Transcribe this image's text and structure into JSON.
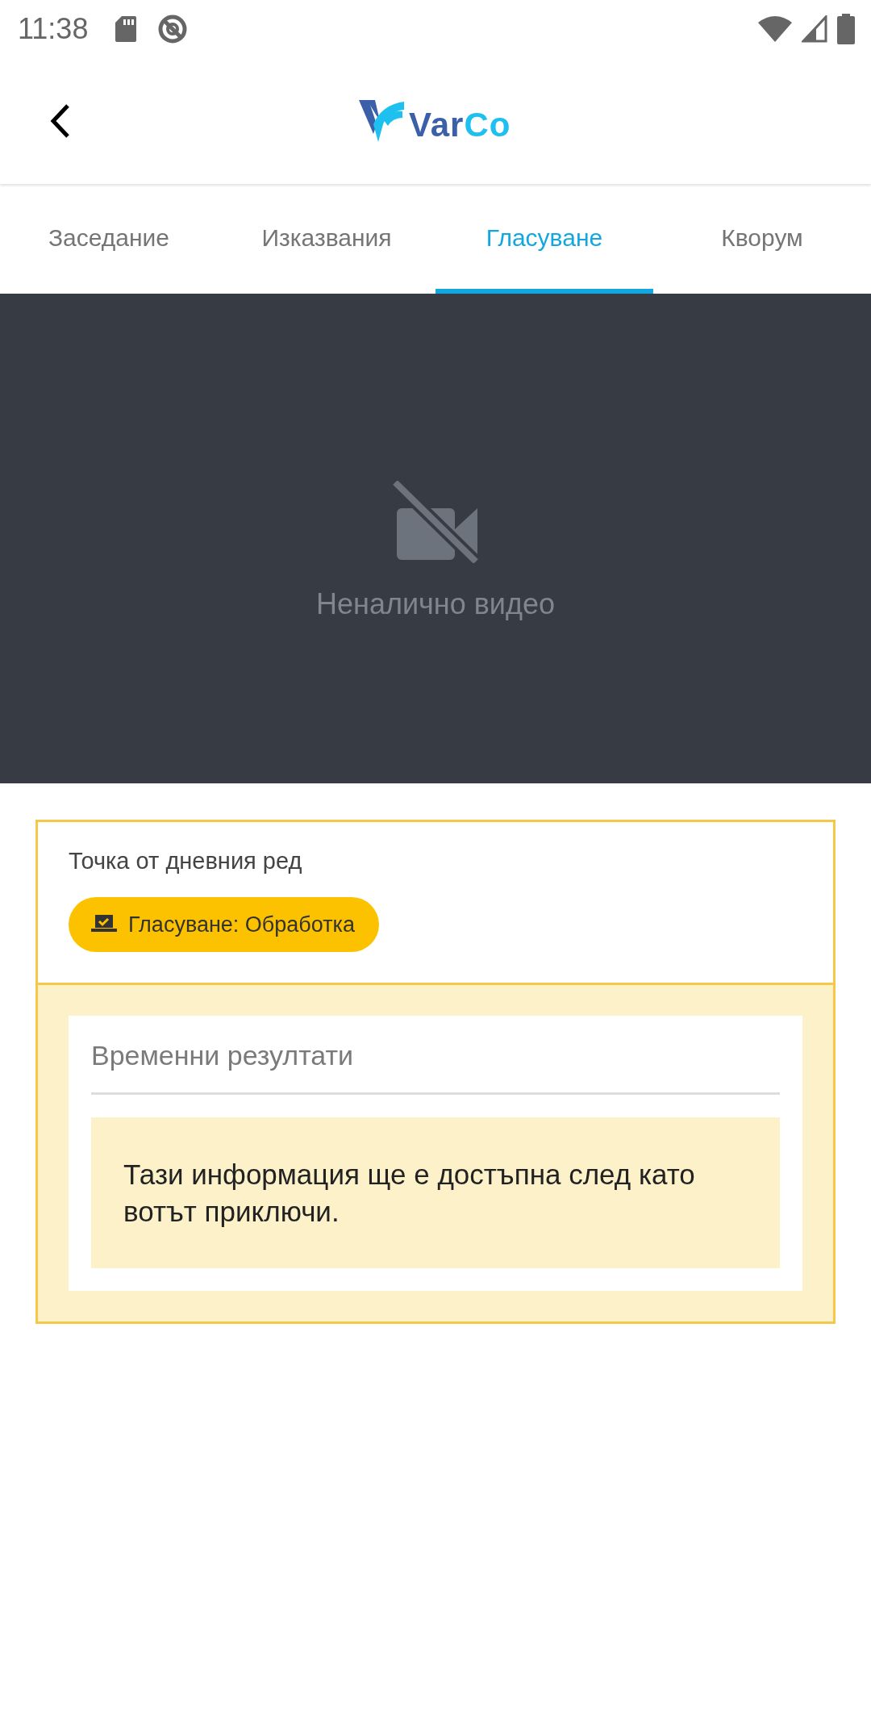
{
  "status_bar": {
    "time": "11:38"
  },
  "app_bar": {
    "logo_parts": [
      {
        "text": "Var",
        "kind": "primary"
      },
      {
        "text": "Co",
        "kind": "accent"
      }
    ]
  },
  "tabs": [
    {
      "label": "Заседание",
      "selected": false
    },
    {
      "label": "Изказвания",
      "selected": false
    },
    {
      "label": "Гласуване",
      "selected": true
    },
    {
      "label": "Кворум",
      "selected": false
    }
  ],
  "video": {
    "message": "Неналично видео"
  },
  "agenda_card": {
    "title": "Точка от дневния ред",
    "status_badge": "Гласуване: Обработка"
  },
  "results": {
    "heading": "Временни резултати",
    "notice": "Тази информация ще е достъпна след като вотът приключи."
  }
}
